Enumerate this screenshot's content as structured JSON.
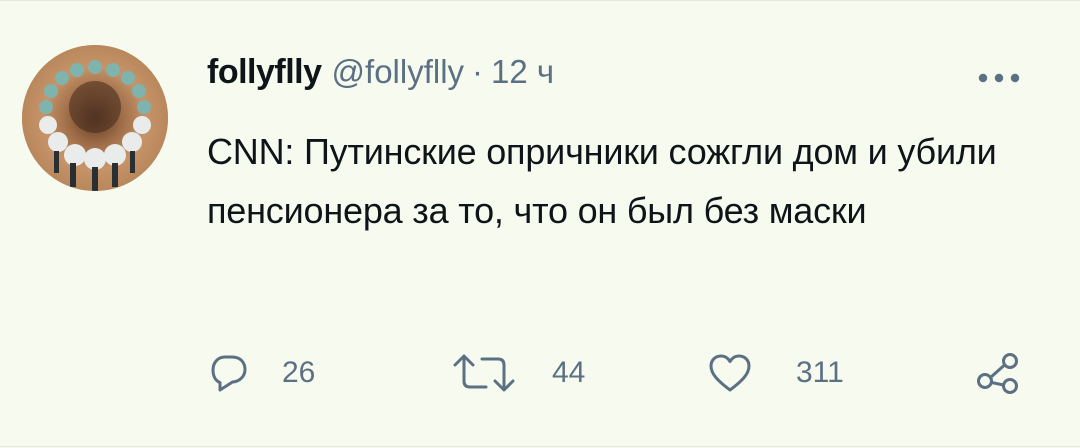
{
  "tweet": {
    "display_name": "follyflly",
    "handle": "@follyflly",
    "separator": "·",
    "time": "12 ч",
    "text": "CNN: Путинские опричники сожгли дом и убили пенсионера за то, что он был без маски"
  },
  "actions": {
    "reply_count": "26",
    "retweet_count": "44",
    "like_count": "311"
  },
  "icons": {
    "more": "more-horizontal-icon",
    "reply": "reply-icon",
    "retweet": "retweet-icon",
    "like": "heart-icon",
    "share": "share-icon"
  },
  "colors": {
    "background": "#f6faef",
    "text": "#0f1419",
    "secondary": "#5b7083"
  }
}
